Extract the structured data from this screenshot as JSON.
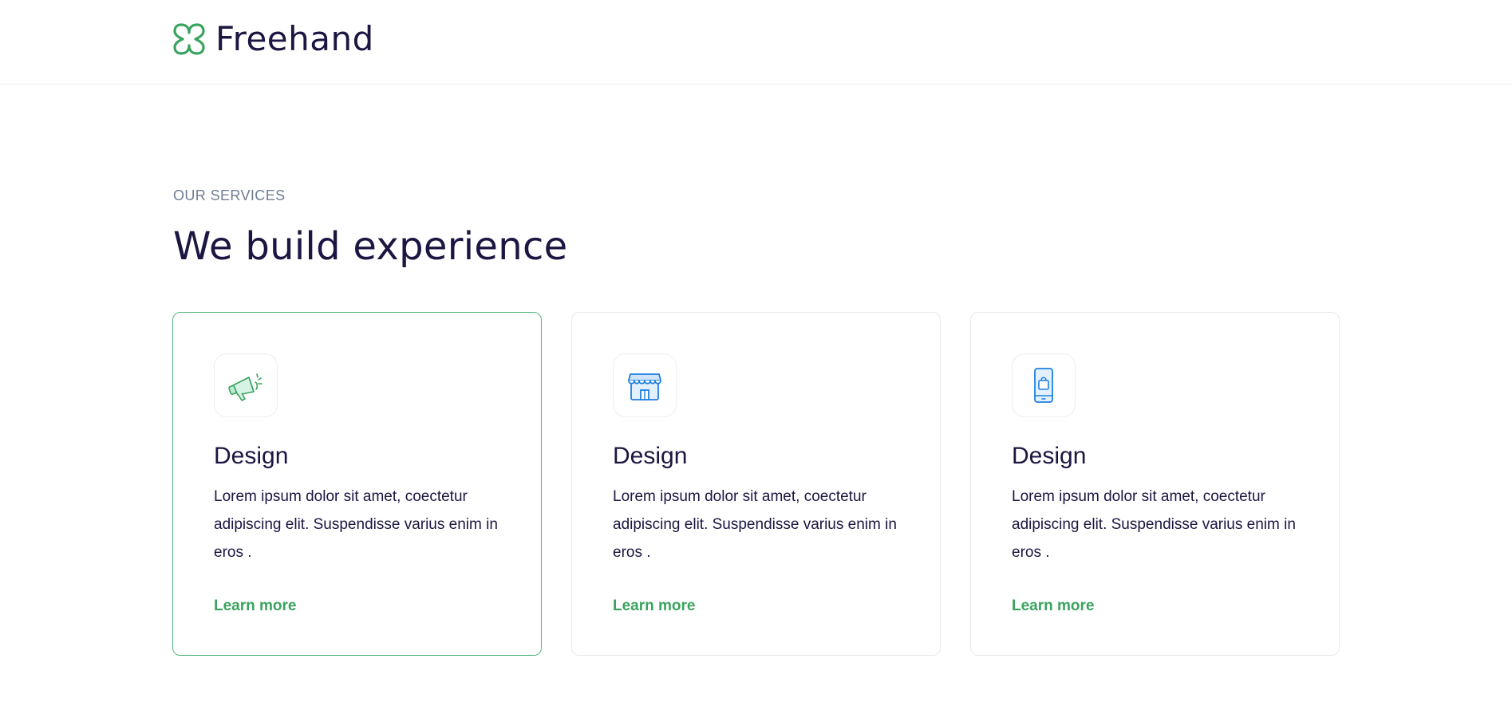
{
  "brand": {
    "name": "Freehand",
    "logo_icon": "clover-logo-icon",
    "accent_color": "#3aa35f"
  },
  "section": {
    "eyebrow": "OUR SERVICES",
    "title": "We build experience"
  },
  "cards": [
    {
      "icon": "megaphone-icon",
      "title": "Design",
      "text": "Lorem ipsum dolor sit amet, coectetur adipiscing elit. Suspendisse varius enim in eros .",
      "link": "Learn more",
      "highlighted": true
    },
    {
      "icon": "storefront-icon",
      "title": "Design",
      "text": "Lorem ipsum dolor sit amet, coectetur adipiscing elit. Suspendisse varius enim in eros .",
      "link": "Learn more",
      "highlighted": false
    },
    {
      "icon": "mobile-shopping-icon",
      "title": "Design",
      "text": "Lorem ipsum dolor sit amet, coectetur adipiscing elit. Suspendisse varius enim in eros .",
      "link": "Learn more",
      "highlighted": false
    }
  ]
}
